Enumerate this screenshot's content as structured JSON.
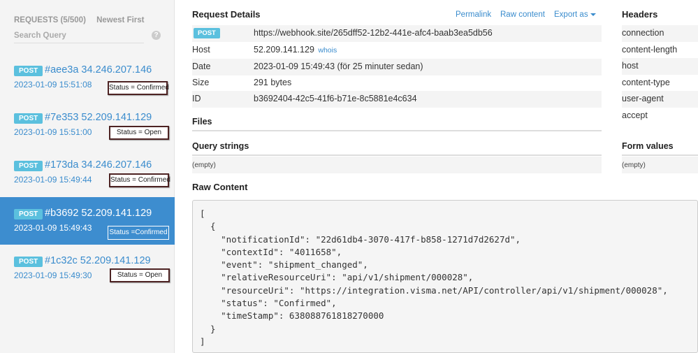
{
  "sidebar": {
    "requests_label": "REQUESTS (5/500)",
    "sort_label": "Newest First",
    "search_placeholder": "Search Query",
    "help_glyph": "?",
    "requests": [
      {
        "method": "POST",
        "title": "#aee3a 34.246.207.146",
        "time": "2023-01-09 15:51:08",
        "status": "Status = Confirmed",
        "active": false
      },
      {
        "method": "POST",
        "title": "#7e353 52.209.141.129",
        "time": "2023-01-09 15:51:00",
        "status": "Status = Open",
        "active": false
      },
      {
        "method": "POST",
        "title": "#173da 34.246.207.146",
        "time": "2023-01-09 15:49:44",
        "status": "Status = Confirmed",
        "active": false
      },
      {
        "method": "POST",
        "title": "#b3692 52.209.141.129",
        "time": "2023-01-09 15:49:43",
        "status": "Status =Confirmed",
        "active": true
      },
      {
        "method": "POST",
        "title": "#1c32c 52.209.141.129",
        "time": "2023-01-09 15:49:30",
        "status": "Status = Open",
        "active": false
      }
    ]
  },
  "details": {
    "title": "Request Details",
    "links": {
      "permalink": "Permalink",
      "raw": "Raw content",
      "export": "Export as"
    },
    "method": "POST",
    "url": "https://webhook.site/265dff52-12b2-441e-afc4-baab3ea5db56",
    "host_label": "Host",
    "host_value": "52.209.141.129",
    "whois": "whois",
    "date_label": "Date",
    "date_value": "2023-01-09 15:49:43 (för 25 minuter sedan)",
    "size_label": "Size",
    "size_value": "291 bytes",
    "id_label": "ID",
    "id_value": "b3692404-42c5-41f6-b71e-8c5881e4c634",
    "files_title": "Files",
    "query_title": "Query strings",
    "query_empty": "(empty)"
  },
  "headers": {
    "title": "Headers",
    "items": [
      "connection",
      "content-length",
      "host",
      "content-type",
      "user-agent",
      "accept"
    ],
    "form_title": "Form values",
    "form_empty": "(empty)"
  },
  "raw": {
    "title": "Raw Content",
    "content": "[\n  {\n    \"notificationId\": \"22d61db4-3070-417f-b858-1271d7d2627d\",\n    \"contextId\": \"4011658\",\n    \"event\": \"shipment_changed\",\n    \"relativeResourceUri\": \"api/v1/shipment/000028\",\n    \"resourceUri\": \"https://integration.visma.net/API/controller/api/v1/shipment/000028\",\n    \"status\": \"Confirmed\",\n    \"timeStamp\": 638088761818270000\n  }\n]"
  },
  "colors": {
    "accent": "#3a8ccd",
    "active_bg": "#3d8dcf",
    "badge": "#5bc0de",
    "status_border": "#4d2323"
  }
}
